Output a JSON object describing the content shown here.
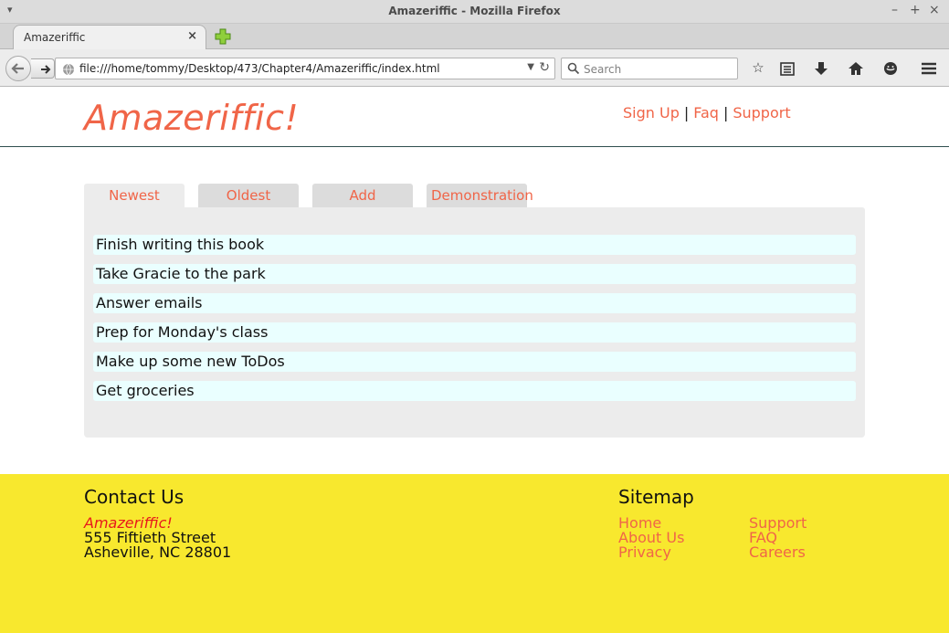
{
  "window": {
    "title": "Amazeriffic - Mozilla Firefox"
  },
  "browser": {
    "tab_title": "Amazeriffic",
    "url": "file:///home/tommy/Desktop/473/Chapter4/Amazeriffic/index.html",
    "search_placeholder": "Search"
  },
  "header": {
    "brand": "Amazeriffic!",
    "nav": [
      {
        "label": "Sign Up"
      },
      {
        "label": "Faq"
      },
      {
        "label": "Support"
      }
    ],
    "separator": "|"
  },
  "tabs": [
    {
      "label": "Newest",
      "active": true
    },
    {
      "label": "Oldest",
      "active": false
    },
    {
      "label": "Add",
      "active": false
    },
    {
      "label": "Demonstration",
      "active": false
    }
  ],
  "todos": [
    "Finish writing this book",
    "Take Gracie to the park",
    "Answer emails",
    "Prep for Monday's class",
    "Make up some new ToDos",
    "Get groceries"
  ],
  "footer": {
    "contact": {
      "heading": "Contact Us",
      "brand": "Amazeriffic!",
      "street": "555 Fiftieth Street",
      "city": "Asheville, NC 28801"
    },
    "sitemap": {
      "heading": "Sitemap",
      "col1": [
        "Home",
        "About Us",
        "Privacy"
      ],
      "col2": [
        "Support",
        "FAQ",
        "Careers"
      ]
    }
  },
  "colors": {
    "accent": "#f06548",
    "footer_bg": "#f8e82e",
    "todo_bg": "#eaffff",
    "panel_bg": "#ececec"
  }
}
